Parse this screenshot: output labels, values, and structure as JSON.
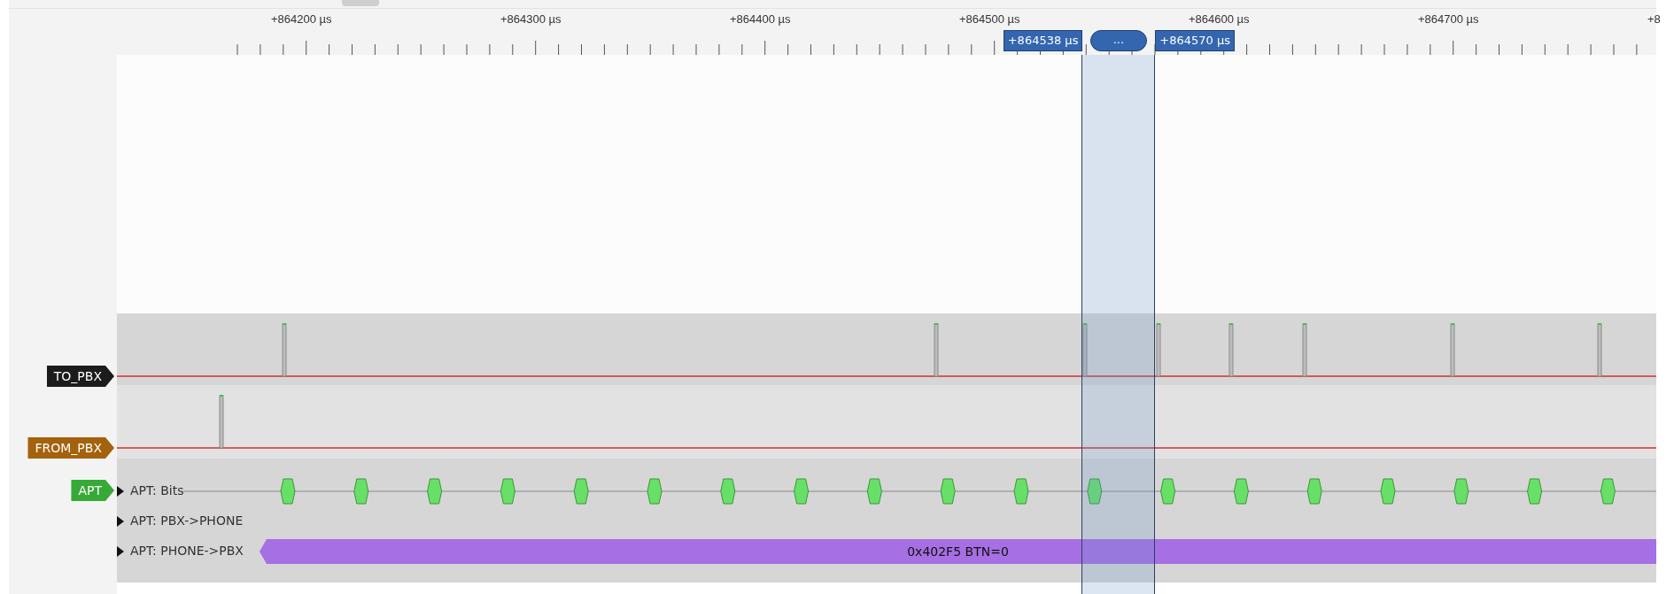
{
  "ruler": {
    "labels": [
      "+864200 µs",
      "+864300 µs",
      "+864400 µs",
      "+864500 µs",
      "+864600 µs",
      "+864700 µs",
      "+8"
    ]
  },
  "cursors": {
    "start": "+864538 µs",
    "width_label": "...",
    "end": "+864570 µs"
  },
  "signals": [
    {
      "name": "TO_PBX",
      "color": "#1c1c1c",
      "kind": "logic"
    },
    {
      "name": "FROM_PBX",
      "color": "#a4620c",
      "kind": "logic"
    }
  ],
  "decoder": {
    "name": "APT",
    "color": "#36a936",
    "rows": [
      {
        "label": "APT: Bits",
        "kind": "bits",
        "expanded": false
      },
      {
        "label": "APT: PBX->PHONE",
        "kind": "empty",
        "expanded": false
      },
      {
        "label": "APT: PHONE->PBX",
        "kind": "annotation",
        "expanded": false,
        "annotation": "0x402F5 BTN=0"
      }
    ]
  }
}
